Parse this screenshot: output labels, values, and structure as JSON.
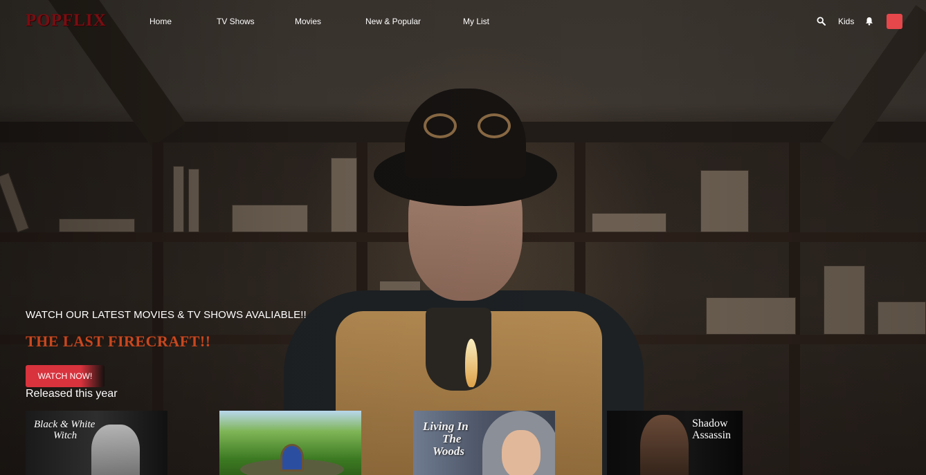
{
  "brand": {
    "logo_text": "POPFLIX"
  },
  "nav": {
    "links": [
      "Home",
      "TV Shows",
      "Movies",
      "New & Popular",
      "My List"
    ],
    "kids_label": "Kids",
    "icons": [
      "search-icon",
      "bell-icon"
    ],
    "avatar_color": "#e5474b"
  },
  "hero": {
    "tagline": "WATCH OUR LATEST MOVIES & TV SHOWS AVALIABLE!!",
    "title": "THE LAST FIRECRAFT!!",
    "title_color": "#c9471e",
    "cta_label": "WATCH NOW!",
    "cta_color": "#d9333d"
  },
  "row": {
    "title": "Released this year",
    "items": [
      {
        "caption_line1": "Black & White",
        "caption_line2": "Witch"
      },
      {
        "caption_line1": "",
        "caption_line2": ""
      },
      {
        "caption_line1": "Living In",
        "caption_line2": "The",
        "caption_line3": "Woods"
      },
      {
        "caption_line1": "Shadow",
        "caption_line2": "Assassin"
      }
    ]
  }
}
